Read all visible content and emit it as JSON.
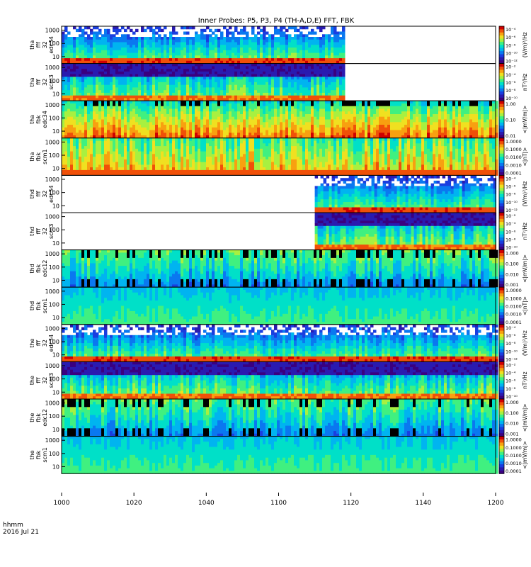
{
  "chart_data": {
    "type": "heatmap",
    "title": "Inner Probes: P5, P3, P4 (TH-A,D,E) FFT, FBK",
    "time_axis": {
      "title": "hhmm",
      "date": "2016 Jul 21",
      "range_hhmm": [
        1000,
        1200
      ],
      "ticks": [
        "1000",
        "1020",
        "1040",
        "1100",
        "1120",
        "1140",
        "1200"
      ]
    },
    "y_scale": "log",
    "freq_ticks": [
      "10",
      "100",
      "1000"
    ],
    "panels": [
      {
        "label_lines": [
          "tha",
          "fff",
          "32",
          "edc34"
        ],
        "unit": "(V/m)²/Hz",
        "colorbar_ticks": [
          "10⁻⁴",
          "10⁻⁶",
          "10⁻⁸",
          "10⁻¹⁰",
          "10⁻¹²"
        ],
        "data_time_range": [
          1000,
          1118
        ],
        "texture": "fft_e"
      },
      {
        "label_lines": [
          "tha",
          "fff",
          "32",
          "scm3"
        ],
        "unit": "nT²/Hz",
        "colorbar_ticks": [
          "10⁻²",
          "10⁻⁴",
          "10⁻⁶",
          "10⁻⁸",
          "10⁻¹⁰"
        ],
        "data_time_range": [
          1000,
          1118
        ],
        "texture": "fft_b"
      },
      {
        "label_lines": [
          "tha",
          "fbk",
          "edc34"
        ],
        "unit": "<|mV/m|>",
        "colorbar_ticks": [
          "1.00",
          "0.10",
          "0.01"
        ],
        "data_time_range": [
          1000,
          1200
        ],
        "texture": "fbk_e_hot"
      },
      {
        "label_lines": [
          "tha",
          "fbk",
          "scm1"
        ],
        "unit": "<|nT|>",
        "colorbar_ticks": [
          "1.0000",
          "0.1000",
          "0.0100",
          "0.0010",
          "0.0001"
        ],
        "data_time_range": [
          1000,
          1200
        ],
        "texture": "fbk_b"
      },
      {
        "label_lines": [
          "thd",
          "fff",
          "32",
          "edc34"
        ],
        "unit": "(V/m)²/Hz",
        "colorbar_ticks": [
          "10⁻⁴",
          "10⁻⁶",
          "10⁻⁸",
          "10⁻¹⁰",
          "10⁻¹²"
        ],
        "data_time_range": [
          1110,
          1200
        ],
        "texture": "fft_e"
      },
      {
        "label_lines": [
          "thd",
          "fff",
          "32",
          "scm3"
        ],
        "unit": "nT²/Hz",
        "colorbar_ticks": [
          "10⁻²",
          "10⁻⁴",
          "10⁻⁶",
          "10⁻⁸",
          "10⁻¹⁰"
        ],
        "data_time_range": [
          1110,
          1200
        ],
        "texture": "fft_b"
      },
      {
        "label_lines": [
          "thd",
          "fbk",
          "edc12"
        ],
        "unit": "<|mV/m|>",
        "colorbar_ticks": [
          "1.000",
          "0.100",
          "0.010",
          "0.001"
        ],
        "data_time_range": [
          1000,
          1200
        ],
        "texture": "fbk_e_dark"
      },
      {
        "label_lines": [
          "thd",
          "fbk",
          "scm1"
        ],
        "unit": "<|nT|>",
        "colorbar_ticks": [
          "1.0000",
          "0.1000",
          "0.0100",
          "0.0010",
          "0.0001"
        ],
        "data_time_range": [
          1000,
          1200
        ],
        "texture": "fbk_b_quiet"
      },
      {
        "label_lines": [
          "the",
          "fff",
          "32",
          "edc34"
        ],
        "unit": "(V/m)²/Hz",
        "colorbar_ticks": [
          "10⁻⁴",
          "10⁻⁶",
          "10⁻⁸",
          "10⁻¹⁰",
          "10⁻¹²"
        ],
        "data_time_range": [
          1000,
          1200
        ],
        "texture": "fft_e"
      },
      {
        "label_lines": [
          "the",
          "fff",
          "32",
          "scm3"
        ],
        "unit": "nT²/Hz",
        "colorbar_ticks": [
          "10⁻²",
          "10⁻⁴",
          "10⁻⁶",
          "10⁻⁸",
          "10⁻¹⁰"
        ],
        "data_time_range": [
          1000,
          1200
        ],
        "texture": "fft_b"
      },
      {
        "label_lines": [
          "the",
          "fbk",
          "edc12"
        ],
        "unit": "<|mV/m|>",
        "colorbar_ticks": [
          "1.000",
          "0.100",
          "0.010",
          "0.001"
        ],
        "data_time_range": [
          1000,
          1200
        ],
        "texture": "fbk_e_dark"
      },
      {
        "label_lines": [
          "the",
          "fbk",
          "scm1"
        ],
        "unit": "<|mV/m|>",
        "colorbar_ticks": [
          "1.0000",
          "0.1000",
          "0.0100",
          "0.0010",
          "0.0001"
        ],
        "data_time_range": [
          1000,
          1200
        ],
        "texture": "fbk_b_quiet"
      }
    ]
  }
}
